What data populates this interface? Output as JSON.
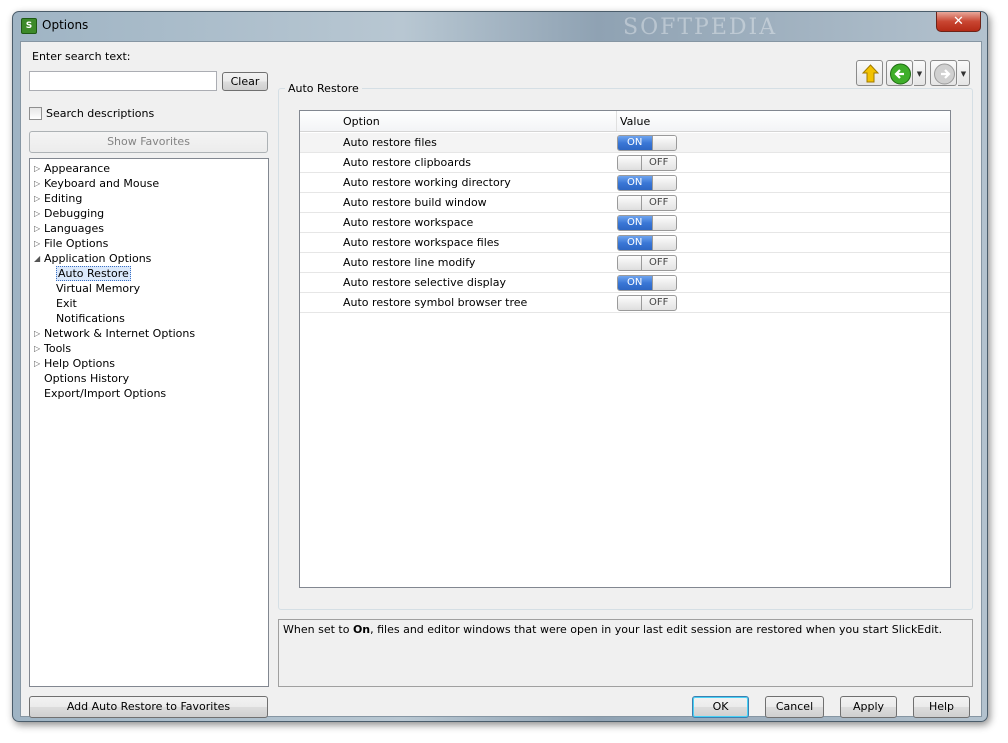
{
  "window": {
    "title": "Options",
    "app_icon": "slickedit-icon",
    "watermark": "SOFTPEDIA"
  },
  "left": {
    "search_label": "Enter search text:",
    "search_value": "",
    "clear_label": "Clear",
    "search_descriptions_label": "Search descriptions",
    "search_descriptions_checked": false,
    "show_favorites_label": "Show Favorites",
    "tree": [
      {
        "label": "Appearance",
        "expander": "collapsed",
        "level": 0
      },
      {
        "label": "Keyboard and Mouse",
        "expander": "collapsed",
        "level": 0
      },
      {
        "label": "Editing",
        "expander": "collapsed",
        "level": 0
      },
      {
        "label": "Debugging",
        "expander": "collapsed",
        "level": 0
      },
      {
        "label": "Languages",
        "expander": "collapsed",
        "level": 0
      },
      {
        "label": "File Options",
        "expander": "collapsed",
        "level": 0
      },
      {
        "label": "Application Options",
        "expander": "expanded",
        "level": 0
      },
      {
        "label": "Auto Restore",
        "expander": "none",
        "level": 1,
        "selected": true
      },
      {
        "label": "Virtual Memory",
        "expander": "none",
        "level": 1
      },
      {
        "label": "Exit",
        "expander": "none",
        "level": 1
      },
      {
        "label": "Notifications",
        "expander": "none",
        "level": 1
      },
      {
        "label": "Network & Internet Options",
        "expander": "collapsed",
        "level": 0
      },
      {
        "label": "Tools",
        "expander": "collapsed",
        "level": 0
      },
      {
        "label": "Help Options",
        "expander": "collapsed",
        "level": 0
      },
      {
        "label": "Options History",
        "expander": "none",
        "level": 0
      },
      {
        "label": "Export/Import Options",
        "expander": "none",
        "level": 0
      }
    ],
    "add_favorites_label": "Add Auto Restore to Favorites"
  },
  "right": {
    "group_label": "Auto Restore",
    "columns": [
      "Option",
      "Value"
    ],
    "rows": [
      {
        "option": "Auto restore files",
        "value": "ON"
      },
      {
        "option": "Auto restore clipboards",
        "value": "OFF"
      },
      {
        "option": "Auto restore working directory",
        "value": "ON"
      },
      {
        "option": "Auto restore build window",
        "value": "OFF"
      },
      {
        "option": "Auto restore workspace",
        "value": "ON"
      },
      {
        "option": "Auto restore workspace files",
        "value": "ON"
      },
      {
        "option": "Auto restore line modify",
        "value": "OFF"
      },
      {
        "option": "Auto restore selective display",
        "value": "ON"
      },
      {
        "option": "Auto restore symbol browser tree",
        "value": "OFF"
      }
    ],
    "description_prefix": "When set to ",
    "description_bold": "On",
    "description_suffix": ", files and editor windows that were open in your last edit session are restored when you start SlickEdit."
  },
  "nav": {
    "up_icon": "up-arrow-icon",
    "back_icon": "back-arrow-icon",
    "forward_icon": "forward-arrow-icon"
  },
  "footer": {
    "ok_label": "OK",
    "cancel_label": "Cancel",
    "apply_label": "Apply",
    "help_label": "Help"
  },
  "colors": {
    "toggle_on": "#3a77d6",
    "selection": "#dbe9fb",
    "nav_up": "#f2c200",
    "nav_back": "#3fae2a"
  }
}
